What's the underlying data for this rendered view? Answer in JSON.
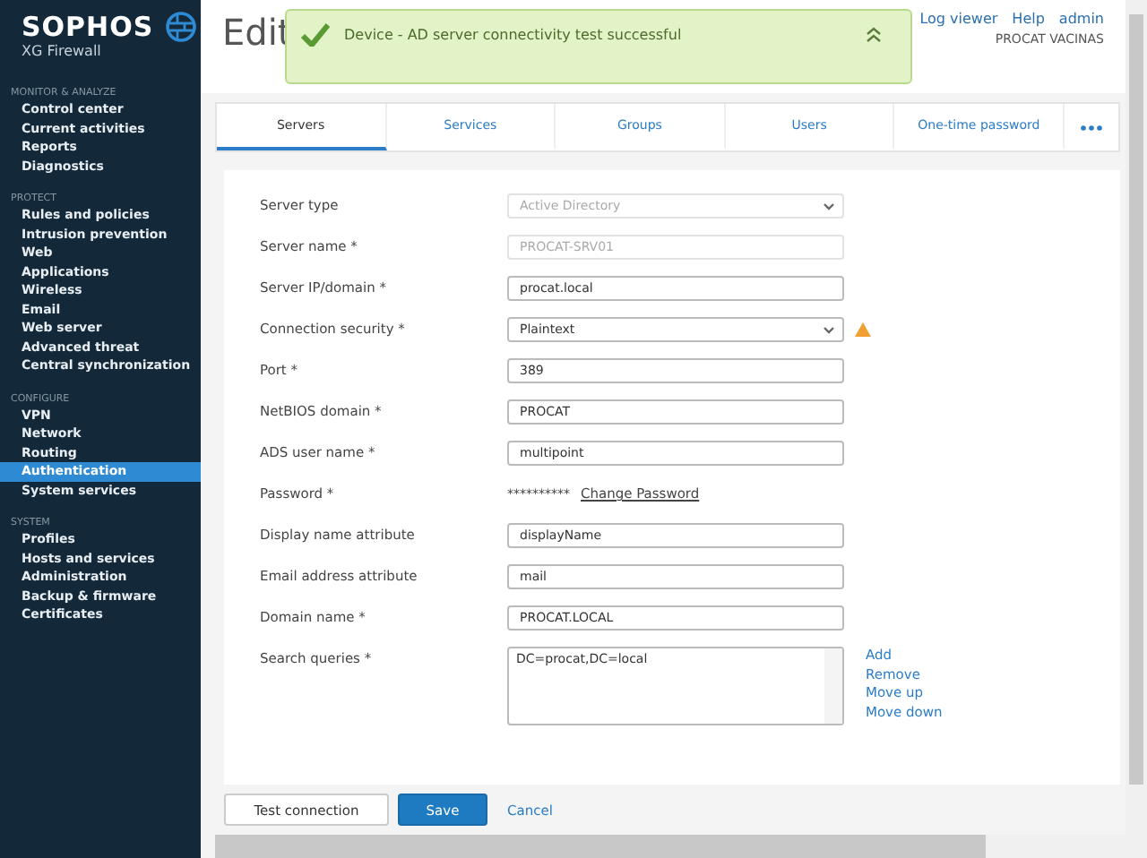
{
  "brand": {
    "name": "SOPHOS",
    "product": "XG Firewall"
  },
  "sidebar": [
    {
      "heading": "MONITOR & ANALYZE",
      "items": [
        {
          "label": "Control center",
          "selected": false
        },
        {
          "label": "Current activities",
          "selected": false
        },
        {
          "label": "Reports",
          "selected": false
        },
        {
          "label": "Diagnostics",
          "selected": false
        }
      ]
    },
    {
      "heading": "PROTECT",
      "items": [
        {
          "label": "Rules and policies",
          "selected": false
        },
        {
          "label": "Intrusion prevention",
          "selected": false
        },
        {
          "label": "Web",
          "selected": false
        },
        {
          "label": "Applications",
          "selected": false
        },
        {
          "label": "Wireless",
          "selected": false
        },
        {
          "label": "Email",
          "selected": false
        },
        {
          "label": "Web server",
          "selected": false
        },
        {
          "label": "Advanced threat",
          "selected": false
        },
        {
          "label": "Central synchronization",
          "selected": false
        }
      ]
    },
    {
      "heading": "CONFIGURE",
      "items": [
        {
          "label": "VPN",
          "selected": false
        },
        {
          "label": "Network",
          "selected": false
        },
        {
          "label": "Routing",
          "selected": false
        },
        {
          "label": "Authentication",
          "selected": true
        },
        {
          "label": "System services",
          "selected": false
        }
      ]
    },
    {
      "heading": "SYSTEM",
      "items": [
        {
          "label": "Profiles",
          "selected": false
        },
        {
          "label": "Hosts and services",
          "selected": false
        },
        {
          "label": "Administration",
          "selected": false
        },
        {
          "label": "Backup & firmware",
          "selected": false
        },
        {
          "label": "Certificates",
          "selected": false
        }
      ]
    }
  ],
  "page_title": "Edit",
  "header_links": [
    "Log viewer",
    "Help",
    "admin"
  ],
  "device_name": "PROCAT VACINAS",
  "toast": {
    "message": "Device - AD server connectivity test successful"
  },
  "tabs": [
    {
      "label": "Servers",
      "selected": true
    },
    {
      "label": "Services",
      "selected": false
    },
    {
      "label": "Groups",
      "selected": false
    },
    {
      "label": "Users",
      "selected": false
    },
    {
      "label": "One-time password",
      "selected": false
    }
  ],
  "fields": [
    {
      "kind": "select",
      "label": "Server type",
      "value": "Active Directory",
      "disabled": true,
      "warning": false
    },
    {
      "kind": "input",
      "label": "Server name *",
      "value": "PROCAT-SRV01",
      "disabled": true,
      "warning": false
    },
    {
      "kind": "input",
      "label": "Server IP/domain *",
      "value": "procat.local",
      "disabled": false,
      "warning": false
    },
    {
      "kind": "select",
      "label": "Connection security *",
      "value": "Plaintext",
      "disabled": false,
      "warning": true
    },
    {
      "kind": "input",
      "label": "Port *",
      "value": "389",
      "disabled": false,
      "warning": false
    },
    {
      "kind": "input",
      "label": "NetBIOS domain *",
      "value": "PROCAT",
      "disabled": false,
      "warning": false
    },
    {
      "kind": "input",
      "label": "ADS user name *",
      "value": "multipoint",
      "disabled": false,
      "warning": false
    },
    {
      "kind": "password",
      "label": "Password *",
      "value": "**********",
      "link": "Change Password"
    },
    {
      "kind": "input",
      "label": "Display name attribute",
      "value": "displayName",
      "disabled": false,
      "warning": false
    },
    {
      "kind": "input",
      "label": "Email address attribute",
      "value": "mail",
      "disabled": false,
      "warning": false
    },
    {
      "kind": "input",
      "label": "Domain name *",
      "value": "PROCAT.LOCAL",
      "disabled": false,
      "warning": false
    },
    {
      "kind": "list",
      "label": "Search queries *",
      "items": [
        "DC=procat,DC=local"
      ],
      "actions": [
        "Add",
        "Remove",
        "Move up",
        "Move down"
      ]
    }
  ],
  "buttons": [
    {
      "kind": "secondary",
      "label": "Test connection"
    },
    {
      "kind": "primary",
      "label": "Save"
    },
    {
      "kind": "link",
      "label": "Cancel"
    }
  ]
}
